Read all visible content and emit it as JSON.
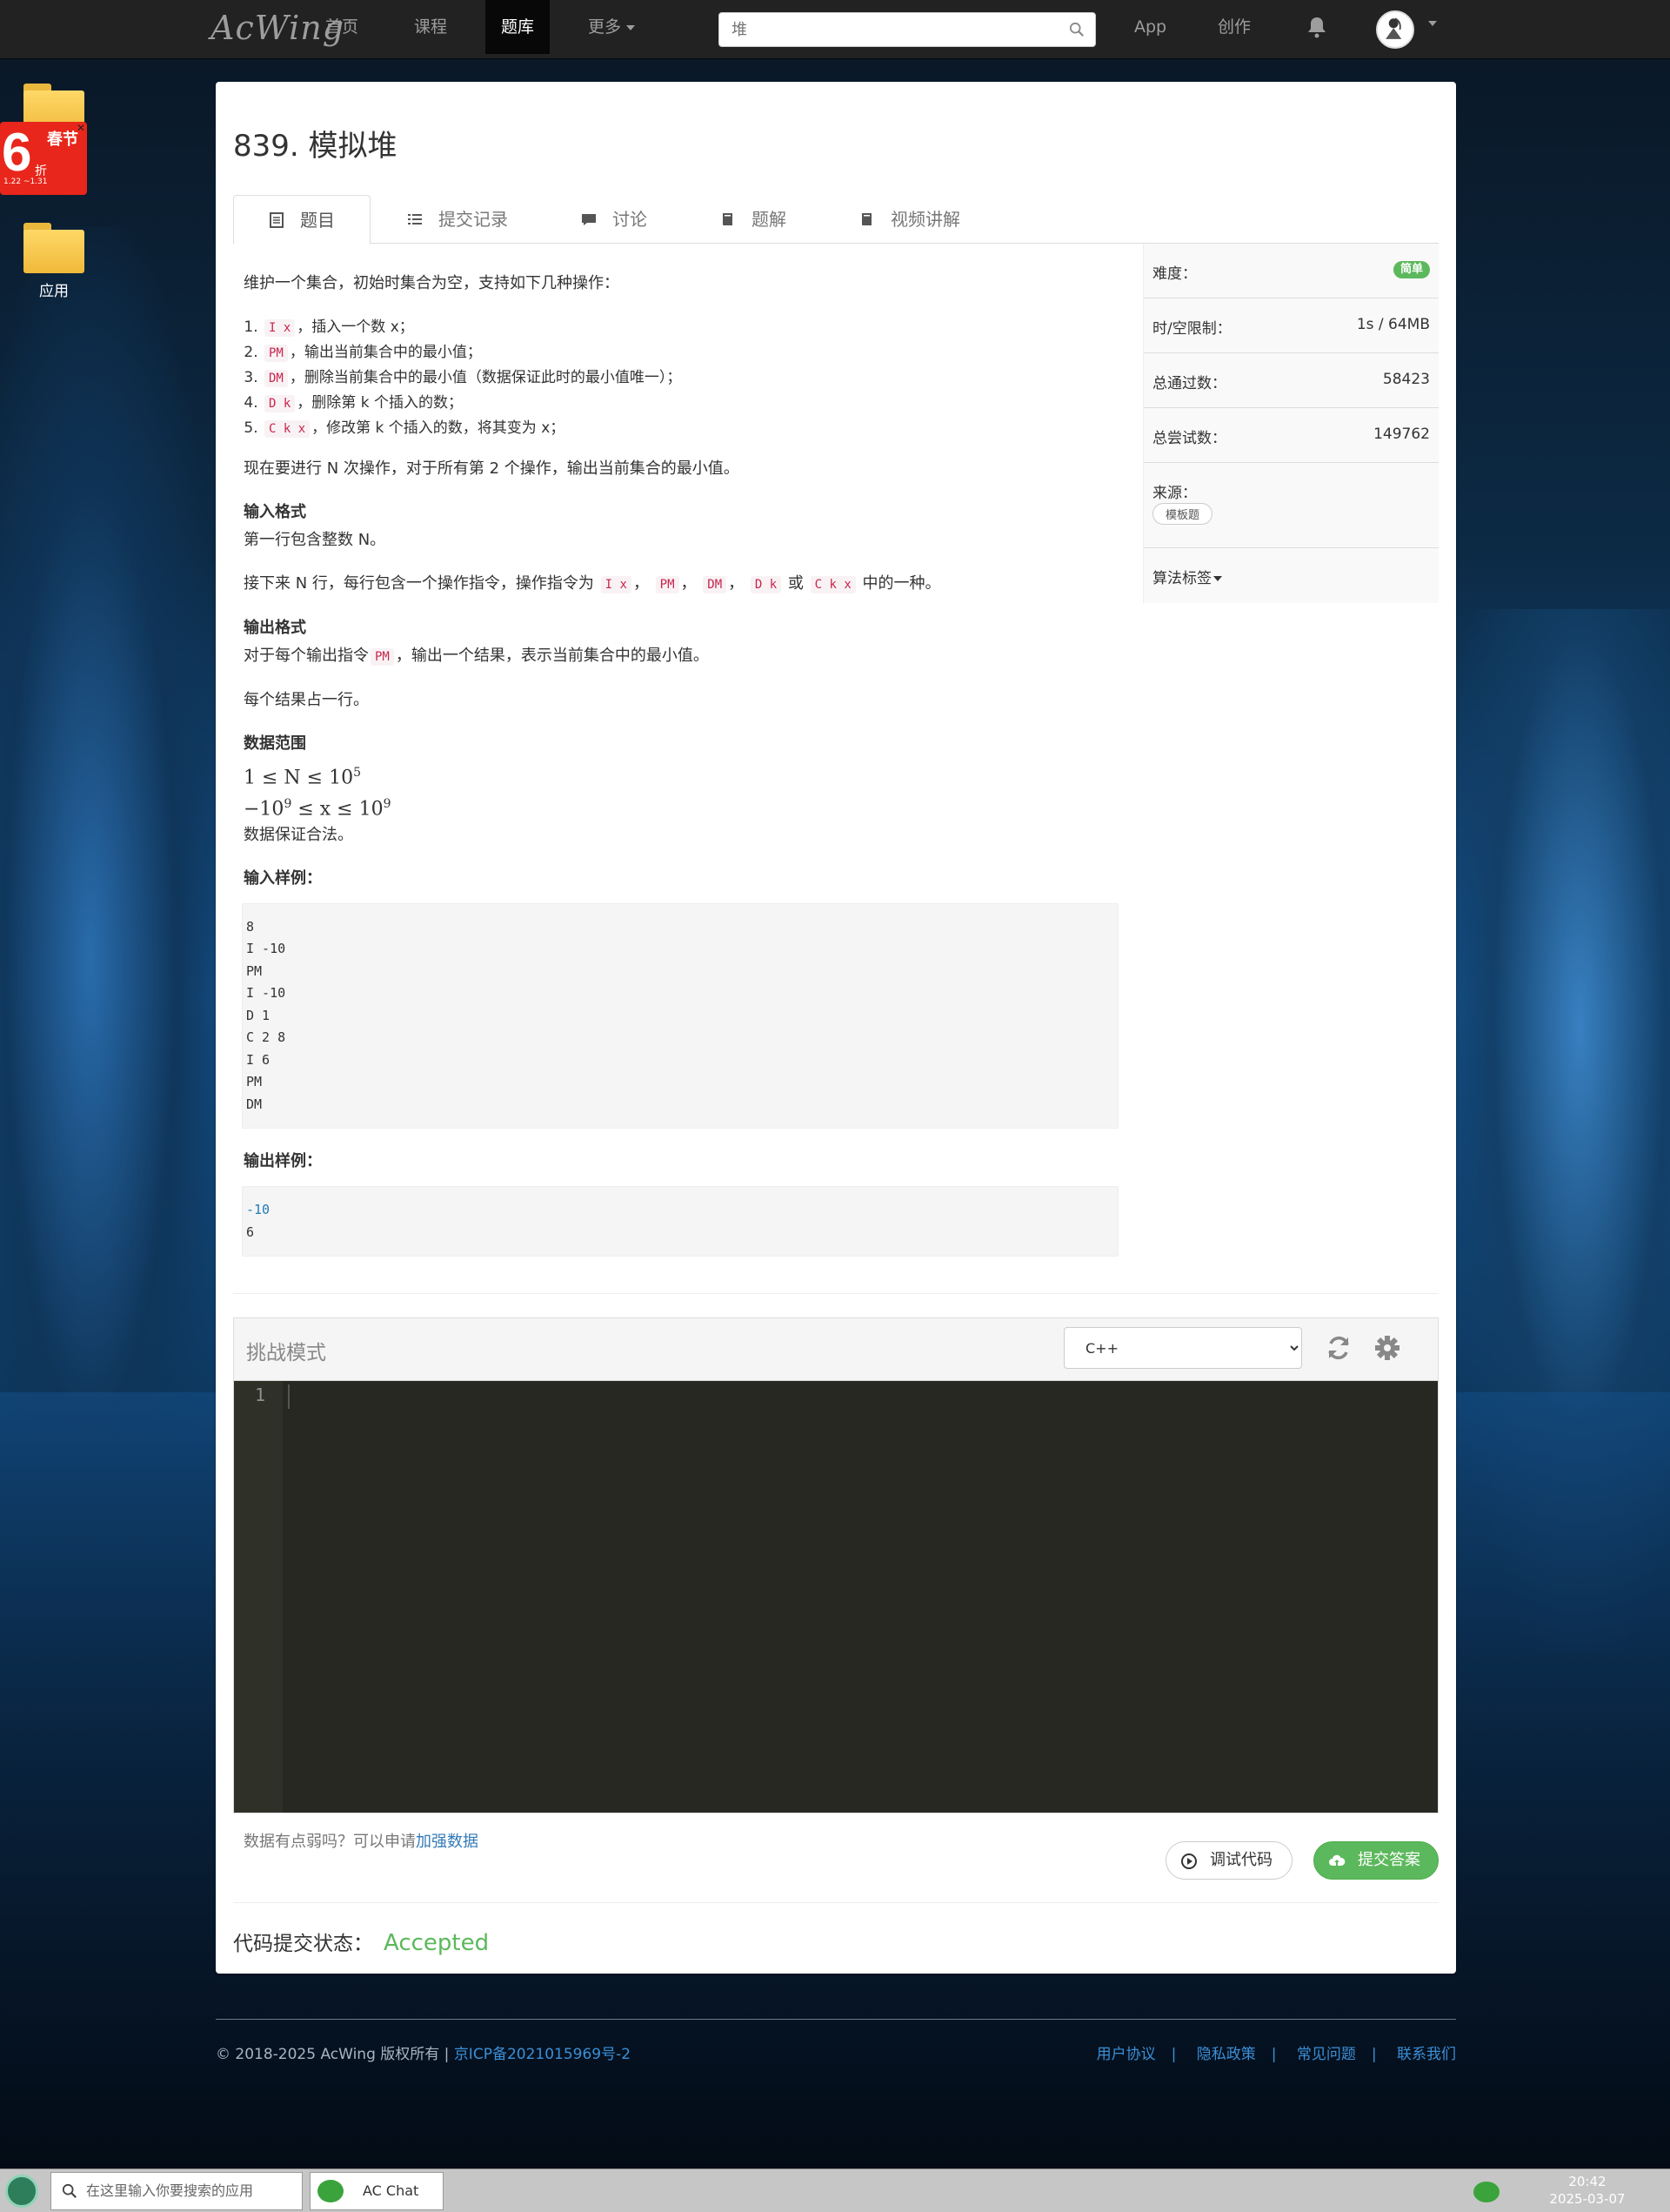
{
  "nav": {
    "logo": "AcWing",
    "items": [
      "首页",
      "课程",
      "题库",
      "更多"
    ],
    "active_index": 2,
    "search_placeholder": "堆",
    "app": "App",
    "create": "创作"
  },
  "desktop": {
    "promo_big": "6",
    "promo_fest": "春节",
    "promo_off": "折",
    "promo_dates": "1.22  ~1.31",
    "app_folder_label": "应用"
  },
  "problem": {
    "title": "839. 模拟堆",
    "tabs": [
      "题目",
      "提交记录",
      "讨论",
      "题解",
      "视频讲解"
    ],
    "intro": "维护一个集合，初始时集合为空，支持如下几种操作：",
    "ops": [
      {
        "code": "I x",
        "text": "，插入一个数 x；"
      },
      {
        "code": "PM",
        "text": "，输出当前集合中的最小值；"
      },
      {
        "code": "DM",
        "text": "，删除当前集合中的最小值（数据保证此时的最小值唯一）；"
      },
      {
        "code": "D k",
        "text": "，删除第 k 个插入的数；"
      },
      {
        "code": "C k x",
        "text": "，修改第 k 个插入的数，将其变为 x；"
      }
    ],
    "task": "现在要进行 N 次操作，对于所有第 2 个操作，输出当前集合的最小值。",
    "input_heading": "输入格式",
    "input_line1": "第一行包含整数 N。",
    "input_line2_a": "接下来 N 行，每行包含一个操作指令，操作指令为",
    "input_codes": [
      "I x",
      "PM",
      "DM",
      "D k",
      "C k x"
    ],
    "input_or": "或",
    "input_line2_b": "中的一种。",
    "output_heading": "输出格式",
    "output_line1_a": "对于每个输出指令",
    "output_code": "PM",
    "output_line1_b": "，输出一个结果，表示当前集合中的最小值。",
    "output_line2": "每个结果占一行。",
    "range_heading": "数据范围",
    "range1": "1 ≤ N ≤ 10",
    "range1_exp": "5",
    "range2_a": "−10",
    "range2_exp1": "9",
    "range2_b": " ≤ x ≤ 10",
    "range2_exp2": "9",
    "range_note": "数据保证合法。",
    "sample_in_heading": "输入样例：",
    "sample_in": [
      "8",
      "I -10",
      "PM",
      "I -10",
      "D 1",
      "C 2 8",
      "I 6",
      "PM",
      "DM"
    ],
    "sample_out_heading": "输出样例：",
    "sample_out": [
      "-10",
      "6"
    ]
  },
  "info": {
    "difficulty_label": "难度：",
    "difficulty": "简单",
    "limit_label": "时/空限制：",
    "limit": "1s / 64MB",
    "passed_label": "总通过数：",
    "passed": "58423",
    "tried_label": "总尝试数：",
    "tried": "149762",
    "source_label": "来源：",
    "source_tag": "模板题",
    "algo_label": "算法标签"
  },
  "editor": {
    "mode": "挑战模式",
    "language": "C++",
    "line_number": "1",
    "note": "数据有点弱吗？可以申请",
    "note_link": "加强数据",
    "debug_btn": "调试代码",
    "submit_btn": "提交答案",
    "status_label": "代码提交状态：",
    "status": "Accepted"
  },
  "footer": {
    "copyright": "© 2018-2025 AcWing 版权所有 | ",
    "icp": "京ICP备2021015969号-2",
    "links": [
      "用户协议",
      "隐私政策",
      "常见问题",
      "联系我们"
    ]
  },
  "taskbar": {
    "search_placeholder": "在这里输入你要搜索的应用",
    "app": "AC Chat",
    "time": "20:42",
    "date": "2025-03-07"
  },
  "colors": {
    "accent_green": "#5cb85c",
    "nav_bg": "#222222",
    "link": "#337ab7",
    "code_red": "#c7254e"
  }
}
